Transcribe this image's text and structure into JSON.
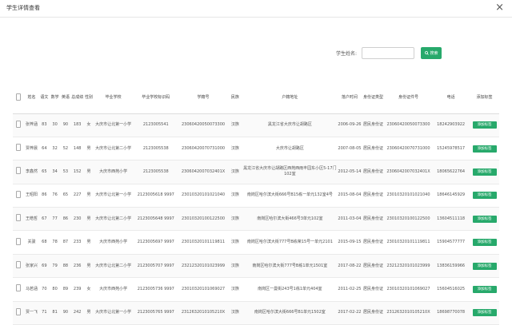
{
  "window": {
    "title": "学生详情查看",
    "close_glyph": "×"
  },
  "search": {
    "label": "学生姓名:",
    "placeholder": "",
    "value": "",
    "button_label": "搜索",
    "button_color": "#27a96b"
  },
  "table": {
    "headers": [
      "",
      "姓名",
      "语文",
      "数学",
      "英语",
      "总成绩",
      "性别",
      "毕业学校",
      "毕业学校标识码",
      "学籍号",
      "民族",
      "户籍地址",
      "落户时间",
      "身份证类型",
      "身份证件号",
      "电话",
      "添加标签"
    ],
    "rows": [
      {
        "name": "张梓涵",
        "chinese": "83",
        "math": "30",
        "english": "90",
        "total": "183",
        "sex": "女",
        "school": "大庆市让北第一小学",
        "school_id": "2123005541",
        "student_no": "23060420050073300",
        "nation": "汉族",
        "address": "黑龙江省大庆市让胡路区",
        "hukou_time": "2006-09-26",
        "id_type": "居民身份证",
        "id_no": "23060420050073300",
        "phone": "18242903922",
        "action": "添加标签"
      },
      {
        "name": "贾梓晨",
        "chinese": "64",
        "math": "32",
        "english": "52",
        "total": "148",
        "sex": "男",
        "school": "大庆市让北第二小学",
        "school_id": "2123005538",
        "student_no": "23060420070731000",
        "nation": "汉族",
        "address": "大庆市让胡路区",
        "hukou_time": "2007-08-05",
        "id_type": "居民身份证",
        "id_no": "23060420070731000",
        "phone": "15245978517",
        "action": "添加标签"
      },
      {
        "name": "李鑫然",
        "chinese": "65",
        "math": "34",
        "english": "53",
        "total": "152",
        "sex": "男",
        "school": "大庆市西苑小学",
        "school_id": "2123005538",
        "student_no": "2306042007032401X",
        "nation": "汉族",
        "address": "黑龙江省大庆市让胡路区西苑西雨丰园东小区5-17门102室",
        "hukou_time": "2012-05-14",
        "id_type": "居民身份证",
        "id_no": "2306042007032401X",
        "phone": "18065622764",
        "action": "添加标签"
      },
      {
        "name": "王昭阳",
        "chinese": "86",
        "math": "76",
        "english": "65",
        "total": "227",
        "sex": "男",
        "school": "大庆市让北第一小学",
        "school_id": "2123005618 9997",
        "student_no": "23010320101021040",
        "nation": "汉族",
        "address": "南岗区哈尔滨大街666号B15栋一单元132室4号",
        "hukou_time": "2015-08-04",
        "id_type": "居民身份证",
        "id_no": "23010320101021040",
        "phone": "18646145929",
        "action": "添加标签"
      },
      {
        "name": "王皓哲",
        "chinese": "67",
        "math": "77",
        "english": "86",
        "total": "230",
        "sex": "男",
        "school": "大庆市让北第二小学",
        "school_id": "2123005648 9997",
        "student_no": "23010320100122500",
        "nation": "汉族",
        "address": "南岗区哈尔滨大街466号3单元102室",
        "hukou_time": "2011-03-04",
        "id_type": "居民身份证",
        "id_no": "23010320100122500",
        "phone": "13604511118",
        "action": "添加标签"
      },
      {
        "name": "关骏",
        "chinese": "68",
        "math": "78",
        "english": "87",
        "total": "233",
        "sex": "男",
        "school": "大庆市西苑小学",
        "school_id": "2123005697 9997",
        "student_no": "23010320101119811",
        "nation": "汉族",
        "address": "南岗区哈尔滨大街777号B栋荣15号一单元2101",
        "hukou_time": "2015-09-15",
        "id_type": "居民身份证",
        "id_no": "23010320101119811",
        "phone": "15904577777",
        "action": "添加标签"
      },
      {
        "name": "张家兴",
        "chinese": "69",
        "math": "79",
        "english": "88",
        "total": "236",
        "sex": "男",
        "school": "大庆市让北第二小学",
        "school_id": "2123005707 9997",
        "student_no": "23212320101023999",
        "nation": "汉族",
        "address": "南岗区哈尔滨大街777号B栋1单元1501室",
        "hukou_time": "2017-08-22",
        "id_type": "居民身份证",
        "id_no": "23212320101023999",
        "phone": "13836159966",
        "action": "添加标签"
      },
      {
        "name": "马若涵",
        "chinese": "70",
        "math": "80",
        "english": "89",
        "total": "239",
        "sex": "女",
        "school": "大庆市西苑小学",
        "school_id": "2123005736 9997",
        "student_no": "23010320101069027",
        "nation": "汉族",
        "address": "南岗区一曼街243号1栋1单元404室",
        "hukou_time": "2011-02-25",
        "id_type": "居民身份证",
        "id_no": "23010320101069027",
        "phone": "15604516025",
        "action": "添加标签"
      },
      {
        "name": "贾一飞",
        "chinese": "71",
        "math": "81",
        "english": "90",
        "total": "242",
        "sex": "男",
        "school": "大庆市让北第一小学",
        "school_id": "2123005765 9997",
        "student_no": "2312632010105210X",
        "nation": "汉族",
        "address": "南岗区哈尔滨大街666号B1单元1502室",
        "hukou_time": "2017-02-22",
        "id_type": "居民身份证",
        "id_no": "2312632010105210X",
        "phone": "18698770078",
        "action": "添加标签"
      }
    ]
  }
}
